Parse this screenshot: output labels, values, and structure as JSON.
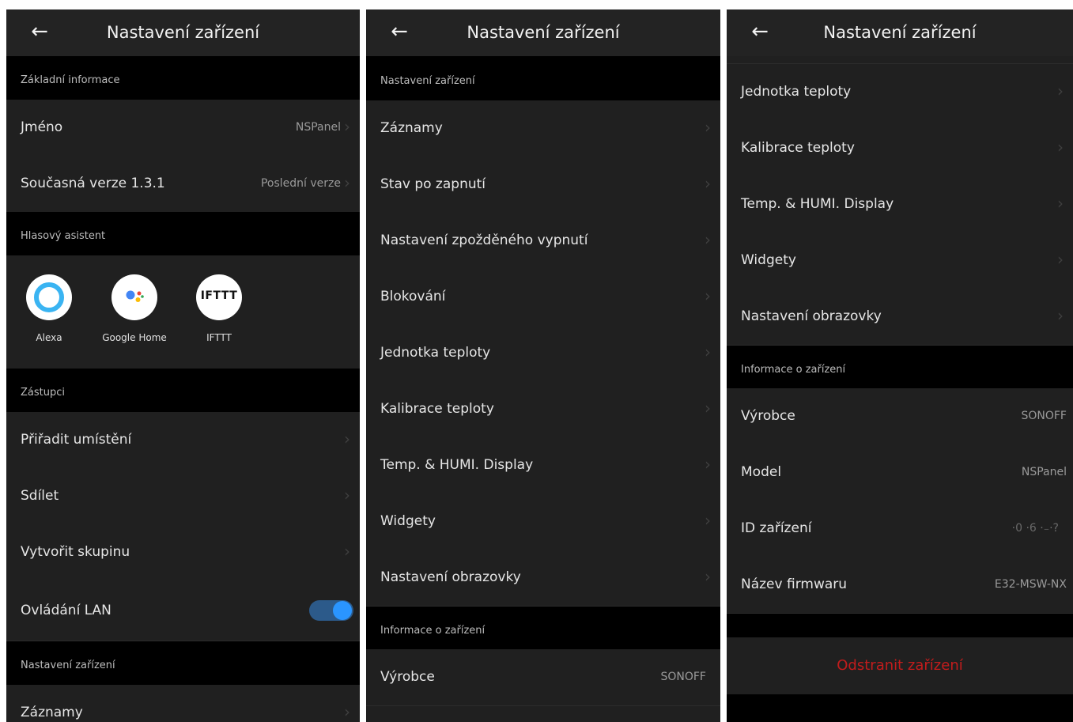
{
  "header": {
    "title": "Nastavení zařízení",
    "back_icon": "←"
  },
  "chevron": "›",
  "colors": {
    "toggle_on": "#2a95ff",
    "danger": "#c21c1c",
    "background": "#202020",
    "section_header": "#000000"
  },
  "panel1": {
    "sec_basic": "Základní informace",
    "name_label": "Jméno",
    "name_value": "NSPanel",
    "version_label": "Současná verze  1.3.1",
    "version_value": "Poslední verze",
    "sec_voice": "Hlasový asistent",
    "assistants": [
      {
        "name": "Alexa",
        "icon": "alexa-icon"
      },
      {
        "name": "Google Home",
        "icon": "google-assistant-icon"
      },
      {
        "name": "IFTTT",
        "icon": "ifttt-icon",
        "logo_text": "IFTTT"
      }
    ],
    "sec_agents": "Zástupci",
    "assign_location": "Přiřadit umístění",
    "share": "Sdílet",
    "create_group": "Vytvořit skupinu",
    "lan_control": "Ovládání LAN",
    "lan_control_on": true,
    "sec_device_settings": "Nastavení zařízení",
    "records": "Záznamy"
  },
  "panel2": {
    "sec_device_settings": "Nastavení zařízení",
    "items": [
      "Záznamy",
      "Stav po zapnutí",
      "Nastavení zpožděného vypnutí",
      "Blokování",
      "Jednotka teploty",
      "Kalibrace teploty",
      "Temp. & HUMI. Display",
      "Widgety",
      "Nastavení obrazovky"
    ],
    "sec_device_info": "Informace o zařízení",
    "manufacturer_label": "Výrobce",
    "manufacturer_value": "SONOFF"
  },
  "panel3": {
    "items": [
      "Jednotka teploty",
      "Kalibrace teploty",
      "Temp. & HUMI. Display",
      "Widgety",
      "Nastavení obrazovky"
    ],
    "sec_device_info": "Informace o zařízení",
    "info": [
      {
        "label": "Výrobce",
        "value": "SONOFF"
      },
      {
        "label": "Model",
        "value": "NSPanel"
      },
      {
        "label": "ID zařízení",
        "value": "·0 ·6 ·₋·?"
      },
      {
        "label": "Název firmwaru",
        "value": "E32-MSW-NX"
      }
    ],
    "delete_device": "Odstranit zařízení"
  }
}
